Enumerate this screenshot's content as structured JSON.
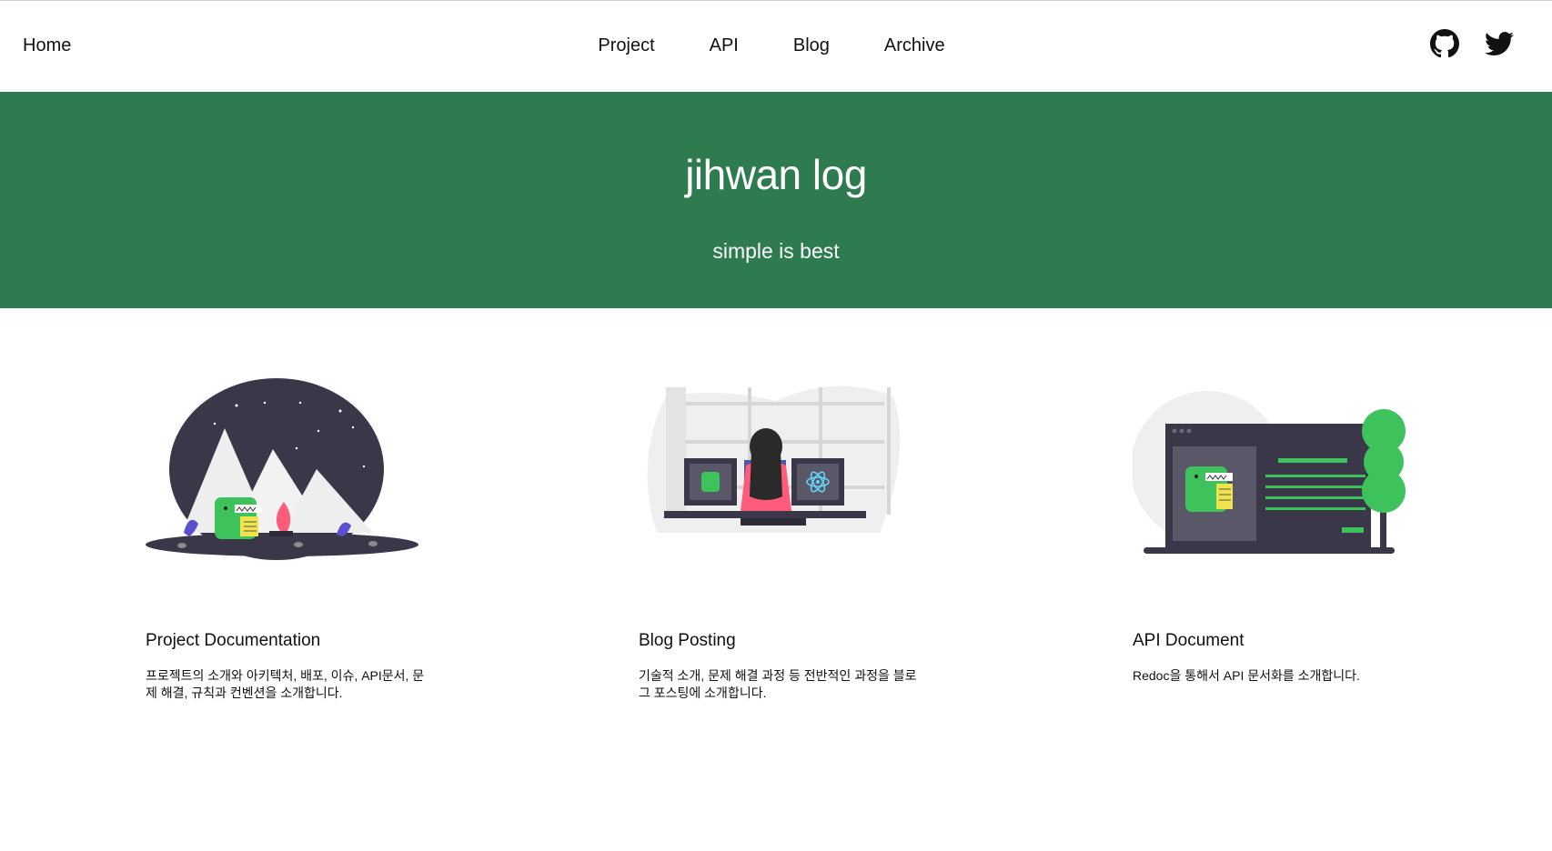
{
  "nav": {
    "home": "Home",
    "links": [
      "Project",
      "API",
      "Blog",
      "Archive"
    ],
    "social_icons": [
      "github-icon",
      "twitter-icon"
    ]
  },
  "hero": {
    "title": "jihwan log",
    "subtitle": "simple is best",
    "background_color": "#2e7b50"
  },
  "cards": [
    {
      "title": "Project Documentation",
      "description": "프로젝트의 소개와 아키텍처, 배포, 이슈, API문서, 문제 해결, 규칙과 컨벤션을 소개합니다.",
      "illustration": "camping-mountains-illustration"
    },
    {
      "title": "Blog Posting",
      "description": "기술적 소개, 문제 해결 과정 등 전반적인 과정을 블로그 포스팅에 소개합니다.",
      "illustration": "developer-desk-illustration"
    },
    {
      "title": "API Document",
      "description": "Redoc을 통해서 API 문서화를 소개합니다.",
      "illustration": "browser-document-illustration"
    }
  ],
  "colors": {
    "accent_green": "#2e7b50",
    "mascot_green": "#3dc25c",
    "dark_navy": "#3a3848"
  }
}
